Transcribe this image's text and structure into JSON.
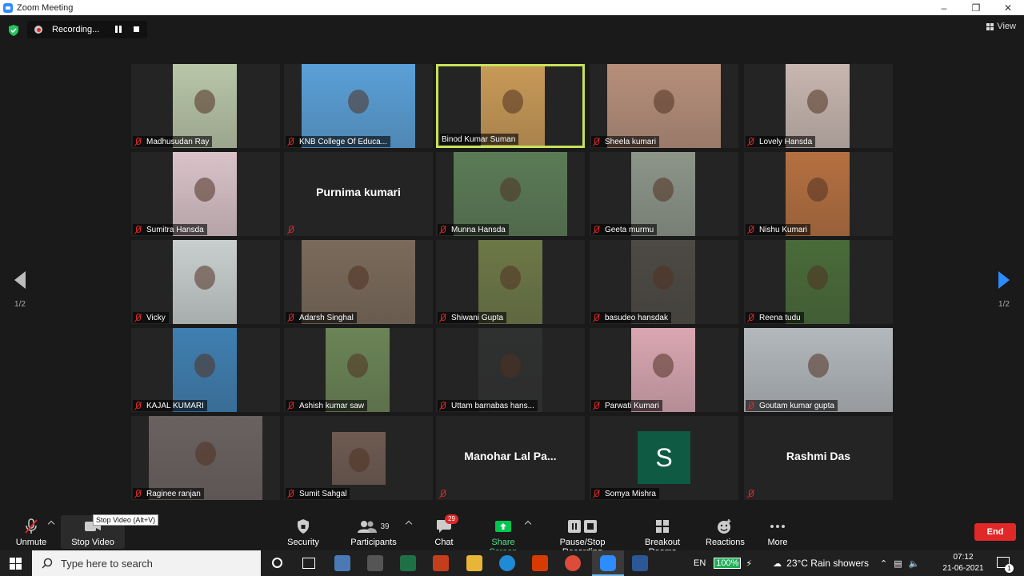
{
  "window": {
    "title": "Zoom Meeting"
  },
  "recording": {
    "label": "Recording..."
  },
  "view": {
    "label": "View"
  },
  "pager": {
    "left": "1/2",
    "right": "1/2"
  },
  "participants": [
    {
      "name": "Madhusudan Ray",
      "kind": "video",
      "bg": "#b9c6a8"
    },
    {
      "name": "KNB College Of Educa...",
      "kind": "video",
      "bg": "#5aa0d8"
    },
    {
      "name": "Binod Kumar Suman",
      "kind": "video",
      "bg": "#c99a57",
      "active": true
    },
    {
      "name": "Sheela kumari",
      "kind": "video",
      "bg": "#b78f7b"
    },
    {
      "name": "Lovely Hansda",
      "kind": "video",
      "bg": "#c8b7b0"
    },
    {
      "name": "Sumitra Hansda",
      "kind": "video",
      "bg": "#d9c3c9"
    },
    {
      "name": "",
      "kind": "name",
      "display": "Purnima kumari"
    },
    {
      "name": "Munna Hansda",
      "kind": "video",
      "bg": "#5b7b56"
    },
    {
      "name": "Geeta murmu",
      "kind": "video",
      "bg": "#8d9589"
    },
    {
      "name": "Nishu Kumari",
      "kind": "video",
      "bg": "#b57040"
    },
    {
      "name": "Vicky",
      "kind": "video",
      "bg": "#c9cfcf"
    },
    {
      "name": "Adarsh Singhal",
      "kind": "video",
      "bg": "#7a6a5a"
    },
    {
      "name": "Shiwani Gupta",
      "kind": "video",
      "bg": "#6d7847"
    },
    {
      "name": "basudeo hansdak",
      "kind": "video",
      "bg": "#4d4a44"
    },
    {
      "name": "Reena tudu",
      "kind": "video",
      "bg": "#496b39"
    },
    {
      "name": "KAJAL KUMARI",
      "kind": "video",
      "bg": "#3f7fb1"
    },
    {
      "name": "Ashish kumar saw",
      "kind": "video",
      "bg": "#6b8456"
    },
    {
      "name": "Uttam barnabas hans...",
      "kind": "video",
      "bg": "#2f3030"
    },
    {
      "name": "Parwati Kumari",
      "kind": "video",
      "bg": "#d9a7b2"
    },
    {
      "name": "Goutam kumar gupta",
      "kind": "video",
      "bg": "#b3b8bc"
    },
    {
      "name": "Raginee ranjan",
      "kind": "video",
      "bg": "#6a6260"
    },
    {
      "name": "Sumit Sahgal",
      "kind": "video",
      "bg": "#6e5b52"
    },
    {
      "name": "",
      "kind": "name",
      "display": "Manohar Lal Pa..."
    },
    {
      "name": "Somya Mishra",
      "kind": "avatar",
      "display": "S"
    },
    {
      "name": "",
      "kind": "name",
      "display": "Rashmi Das"
    }
  ],
  "toolbar": {
    "unmute": "Unmute",
    "stop_video": "Stop Video",
    "stop_video_tooltip": "Stop Video (Alt+V)",
    "security": "Security",
    "participants": "Participants",
    "participants_count": "39",
    "chat": "Chat",
    "chat_badge": "29",
    "share_screen": "Share Screen",
    "recording": "Pause/Stop Recording",
    "breakout": "Breakout Rooms",
    "reactions": "Reactions",
    "more": "More",
    "end": "End"
  },
  "taskbar": {
    "search_placeholder": "Type here to search",
    "language": "EN",
    "battery": "100%",
    "weather": "23°C  Rain showers",
    "time": "07:12",
    "date": "21-06-2021",
    "notifications": "1"
  },
  "colors": {
    "accent": "#2d8cff",
    "active_border": "#c7e25a",
    "end": "#e02828",
    "share": "#00c650"
  }
}
